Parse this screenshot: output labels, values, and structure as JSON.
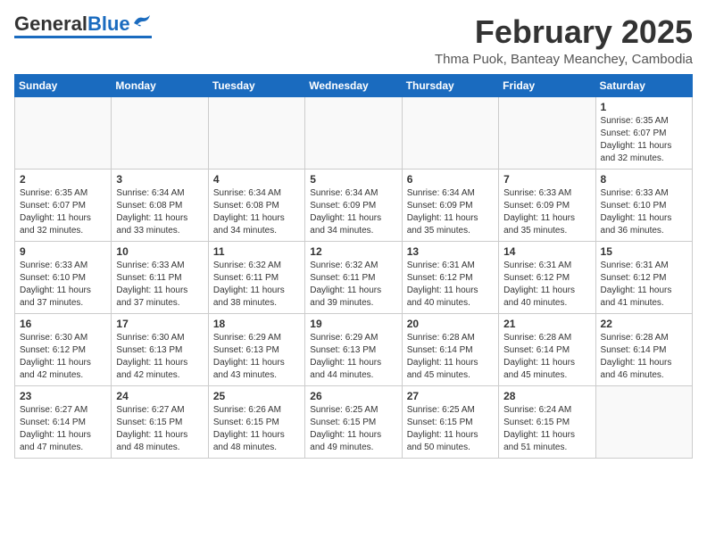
{
  "header": {
    "logo_text_general": "General",
    "logo_text_blue": "Blue",
    "month": "February 2025",
    "location": "Thma Puok, Banteay Meanchey, Cambodia"
  },
  "weekdays": [
    "Sunday",
    "Monday",
    "Tuesday",
    "Wednesday",
    "Thursday",
    "Friday",
    "Saturday"
  ],
  "weeks": [
    [
      {
        "day": "",
        "info": ""
      },
      {
        "day": "",
        "info": ""
      },
      {
        "day": "",
        "info": ""
      },
      {
        "day": "",
        "info": ""
      },
      {
        "day": "",
        "info": ""
      },
      {
        "day": "",
        "info": ""
      },
      {
        "day": "1",
        "info": "Sunrise: 6:35 AM\nSunset: 6:07 PM\nDaylight: 11 hours\nand 32 minutes."
      }
    ],
    [
      {
        "day": "2",
        "info": "Sunrise: 6:35 AM\nSunset: 6:07 PM\nDaylight: 11 hours\nand 32 minutes."
      },
      {
        "day": "3",
        "info": "Sunrise: 6:34 AM\nSunset: 6:08 PM\nDaylight: 11 hours\nand 33 minutes."
      },
      {
        "day": "4",
        "info": "Sunrise: 6:34 AM\nSunset: 6:08 PM\nDaylight: 11 hours\nand 34 minutes."
      },
      {
        "day": "5",
        "info": "Sunrise: 6:34 AM\nSunset: 6:09 PM\nDaylight: 11 hours\nand 34 minutes."
      },
      {
        "day": "6",
        "info": "Sunrise: 6:34 AM\nSunset: 6:09 PM\nDaylight: 11 hours\nand 35 minutes."
      },
      {
        "day": "7",
        "info": "Sunrise: 6:33 AM\nSunset: 6:09 PM\nDaylight: 11 hours\nand 35 minutes."
      },
      {
        "day": "8",
        "info": "Sunrise: 6:33 AM\nSunset: 6:10 PM\nDaylight: 11 hours\nand 36 minutes."
      }
    ],
    [
      {
        "day": "9",
        "info": "Sunrise: 6:33 AM\nSunset: 6:10 PM\nDaylight: 11 hours\nand 37 minutes."
      },
      {
        "day": "10",
        "info": "Sunrise: 6:33 AM\nSunset: 6:11 PM\nDaylight: 11 hours\nand 37 minutes."
      },
      {
        "day": "11",
        "info": "Sunrise: 6:32 AM\nSunset: 6:11 PM\nDaylight: 11 hours\nand 38 minutes."
      },
      {
        "day": "12",
        "info": "Sunrise: 6:32 AM\nSunset: 6:11 PM\nDaylight: 11 hours\nand 39 minutes."
      },
      {
        "day": "13",
        "info": "Sunrise: 6:31 AM\nSunset: 6:12 PM\nDaylight: 11 hours\nand 40 minutes."
      },
      {
        "day": "14",
        "info": "Sunrise: 6:31 AM\nSunset: 6:12 PM\nDaylight: 11 hours\nand 40 minutes."
      },
      {
        "day": "15",
        "info": "Sunrise: 6:31 AM\nSunset: 6:12 PM\nDaylight: 11 hours\nand 41 minutes."
      }
    ],
    [
      {
        "day": "16",
        "info": "Sunrise: 6:30 AM\nSunset: 6:12 PM\nDaylight: 11 hours\nand 42 minutes."
      },
      {
        "day": "17",
        "info": "Sunrise: 6:30 AM\nSunset: 6:13 PM\nDaylight: 11 hours\nand 42 minutes."
      },
      {
        "day": "18",
        "info": "Sunrise: 6:29 AM\nSunset: 6:13 PM\nDaylight: 11 hours\nand 43 minutes."
      },
      {
        "day": "19",
        "info": "Sunrise: 6:29 AM\nSunset: 6:13 PM\nDaylight: 11 hours\nand 44 minutes."
      },
      {
        "day": "20",
        "info": "Sunrise: 6:28 AM\nSunset: 6:14 PM\nDaylight: 11 hours\nand 45 minutes."
      },
      {
        "day": "21",
        "info": "Sunrise: 6:28 AM\nSunset: 6:14 PM\nDaylight: 11 hours\nand 45 minutes."
      },
      {
        "day": "22",
        "info": "Sunrise: 6:28 AM\nSunset: 6:14 PM\nDaylight: 11 hours\nand 46 minutes."
      }
    ],
    [
      {
        "day": "23",
        "info": "Sunrise: 6:27 AM\nSunset: 6:14 PM\nDaylight: 11 hours\nand 47 minutes."
      },
      {
        "day": "24",
        "info": "Sunrise: 6:27 AM\nSunset: 6:15 PM\nDaylight: 11 hours\nand 48 minutes."
      },
      {
        "day": "25",
        "info": "Sunrise: 6:26 AM\nSunset: 6:15 PM\nDaylight: 11 hours\nand 48 minutes."
      },
      {
        "day": "26",
        "info": "Sunrise: 6:25 AM\nSunset: 6:15 PM\nDaylight: 11 hours\nand 49 minutes."
      },
      {
        "day": "27",
        "info": "Sunrise: 6:25 AM\nSunset: 6:15 PM\nDaylight: 11 hours\nand 50 minutes."
      },
      {
        "day": "28",
        "info": "Sunrise: 6:24 AM\nSunset: 6:15 PM\nDaylight: 11 hours\nand 51 minutes."
      },
      {
        "day": "",
        "info": ""
      }
    ]
  ]
}
